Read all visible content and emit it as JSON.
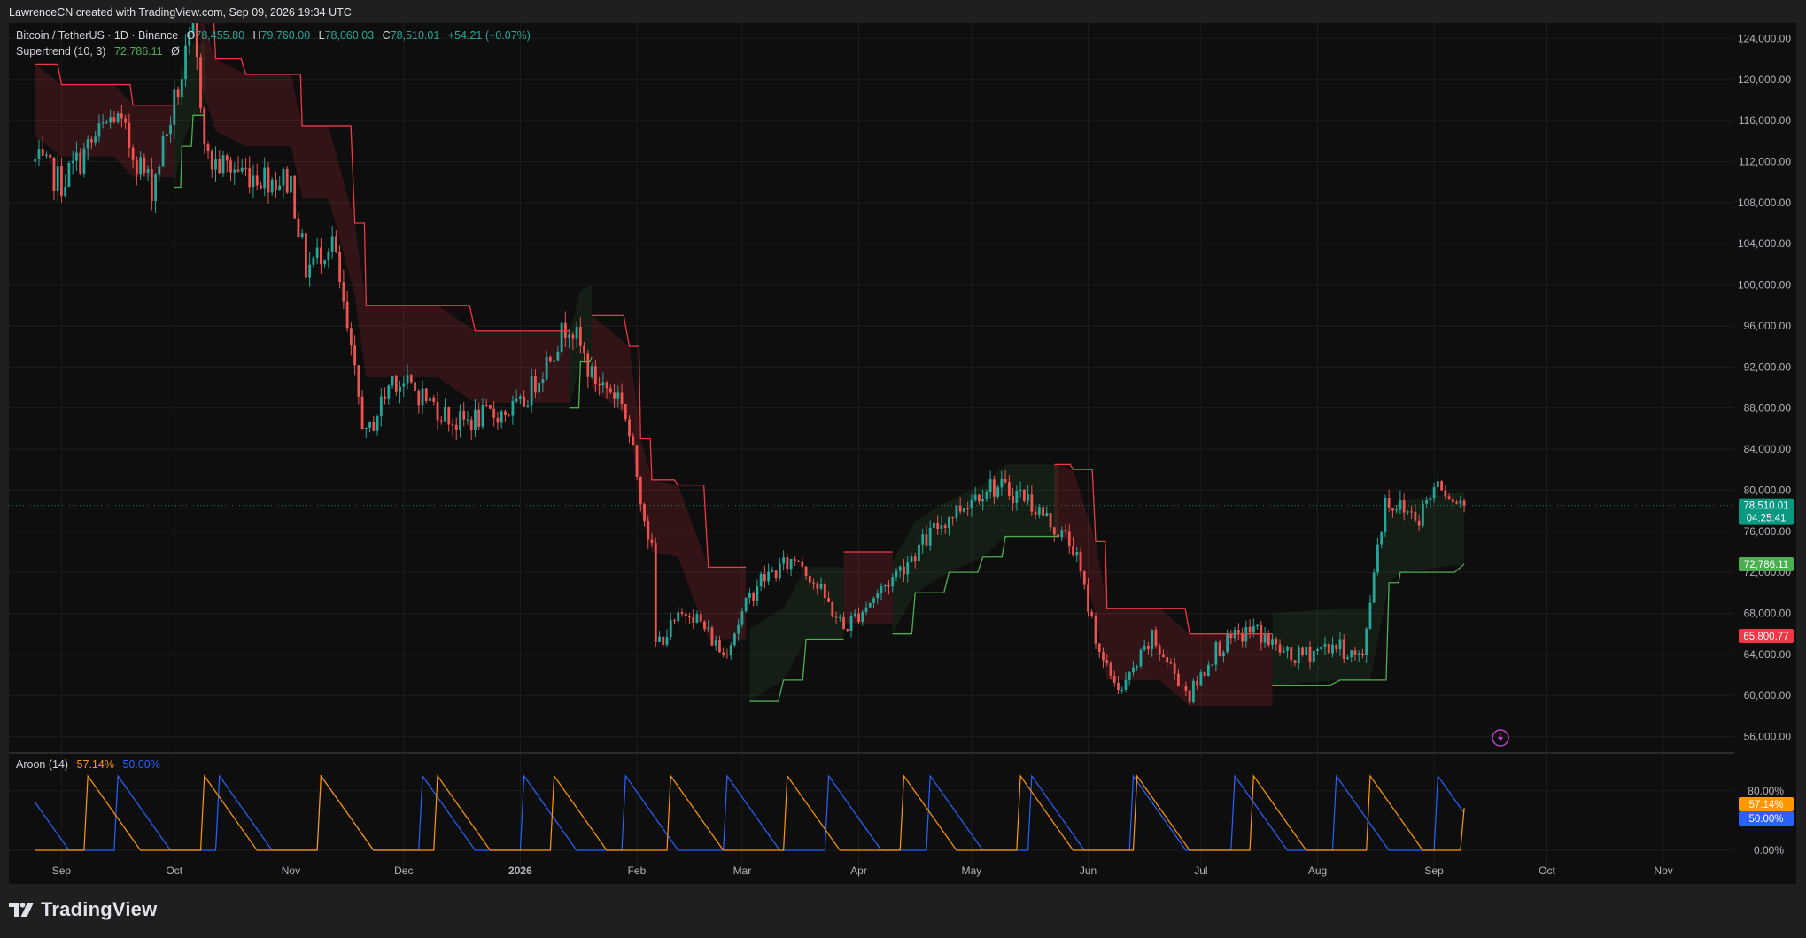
{
  "header": {
    "credit": "LawrenceCN created with TradingView.com, Sep 09, 2026 19:34 UTC"
  },
  "legend": {
    "symbol": "Bitcoin / TetherUS · 1D · Binance",
    "o_label": "O",
    "o_value": "78,455.80",
    "h_label": "H",
    "h_value": "79,760.00",
    "l_label": "L",
    "l_value": "78,060.03",
    "c_label": "C",
    "c_value": "78,510.01",
    "change": "+54.21 (+0.07%)",
    "supertrend_label": "Supertrend (10, 3)",
    "supertrend_value": "72,786.11",
    "supertrend_extra": "Ø",
    "aroon_label": "Aroon (14)",
    "aroon_up": "57.14%",
    "aroon_down": "50.00%"
  },
  "price_badges": {
    "last_price": "78,510.01",
    "countdown": "04:25:41",
    "supertrend_up": "72,786.11",
    "supertrend_down": "65,800.77"
  },
  "oscillator_badges": {
    "up": "57.14%",
    "down": "50.00%"
  },
  "brand": {
    "name": "TradingView"
  },
  "colors": {
    "up": "#26a69a",
    "down": "#ef5350",
    "supertrend_up": "#4caf50",
    "supertrend_down": "#f23645",
    "aroon_up": "#ff9800",
    "aroon_down": "#2962ff"
  },
  "chart_data": {
    "type": "candlestick",
    "y_axis": {
      "range": [
        54500,
        125500
      ],
      "ticks": [
        56000,
        60000,
        64000,
        68000,
        72000,
        76000,
        80000,
        84000,
        88000,
        92000,
        96000,
        100000,
        104000,
        108000,
        112000,
        116000,
        120000,
        124000
      ],
      "tick_labels": [
        "56,000.00",
        "60,000.00",
        "64,000.00",
        "68,000.00",
        "72,000.00",
        "76,000.00",
        "80,000.00",
        "84,000.00",
        "88,000.00",
        "92,000.00",
        "96,000.00",
        "100,000.00",
        "104,000.00",
        "108,000.00",
        "112,000.00",
        "116,000.00",
        "120,000.00",
        "124,000.00"
      ]
    },
    "x_axis": {
      "labels": [
        "Sep",
        "Oct",
        "Nov",
        "Dec",
        "2026",
        "Feb",
        "Mar",
        "Apr",
        "May",
        "Jun",
        "Jul",
        "Aug",
        "Sep",
        "Oct",
        "Nov"
      ]
    },
    "price_points": [
      {
        "date": "2025-08-25",
        "close": 112000
      },
      {
        "date": "2025-09-01",
        "close": 110000
      },
      {
        "date": "2025-09-15",
        "close": 116500
      },
      {
        "date": "2025-09-25",
        "close": 109500
      },
      {
        "date": "2025-10-06",
        "close": 124500
      },
      {
        "date": "2025-10-10",
        "close": 112000
      },
      {
        "date": "2025-10-20",
        "close": 111000
      },
      {
        "date": "2025-11-01",
        "close": 110000
      },
      {
        "date": "2025-11-05",
        "close": 101500
      },
      {
        "date": "2025-11-12",
        "close": 104500
      },
      {
        "date": "2025-11-17",
        "close": 93000
      },
      {
        "date": "2025-11-21",
        "close": 85000
      },
      {
        "date": "2025-11-28",
        "close": 91000
      },
      {
        "date": "2025-12-05",
        "close": 89500
      },
      {
        "date": "2025-12-15",
        "close": 86500
      },
      {
        "date": "2026-01-01",
        "close": 88000
      },
      {
        "date": "2026-01-14",
        "close": 96500
      },
      {
        "date": "2026-01-20",
        "close": 91000
      },
      {
        "date": "2026-01-28",
        "close": 89000
      },
      {
        "date": "2026-02-05",
        "close": 74000
      },
      {
        "date": "2026-02-06",
        "close": 65000
      },
      {
        "date": "2026-02-15",
        "close": 68500
      },
      {
        "date": "2026-02-24",
        "close": 64000
      },
      {
        "date": "2026-03-05",
        "close": 71000
      },
      {
        "date": "2026-03-16",
        "close": 73500
      },
      {
        "date": "2026-03-28",
        "close": 66500
      },
      {
        "date": "2026-04-10",
        "close": 71500
      },
      {
        "date": "2026-04-22",
        "close": 76500
      },
      {
        "date": "2026-05-05",
        "close": 80500
      },
      {
        "date": "2026-05-15",
        "close": 79500
      },
      {
        "date": "2026-05-28",
        "close": 74500
      },
      {
        "date": "2026-06-05",
        "close": 63000
      },
      {
        "date": "2026-06-10",
        "close": 60500
      },
      {
        "date": "2026-06-18",
        "close": 65500
      },
      {
        "date": "2026-06-28",
        "close": 60000
      },
      {
        "date": "2026-07-05",
        "close": 64500
      },
      {
        "date": "2026-07-15",
        "close": 66500
      },
      {
        "date": "2026-07-25",
        "close": 63500
      },
      {
        "date": "2026-08-05",
        "close": 65000
      },
      {
        "date": "2026-08-13",
        "close": 63500
      },
      {
        "date": "2026-08-16",
        "close": 72500
      },
      {
        "date": "2026-08-19",
        "close": 79000
      },
      {
        "date": "2026-08-28",
        "close": 77500
      },
      {
        "date": "2026-09-02",
        "close": 81000
      },
      {
        "date": "2026-09-09",
        "close": 78510
      }
    ],
    "supertrend_segments": [
      {
        "dir": "down",
        "points": [
          [
            "2025-08-25",
            121500
          ],
          [
            "2025-09-01",
            119500
          ],
          [
            "2025-09-15",
            119500
          ],
          [
            "2025-09-20",
            117500
          ],
          [
            "2025-10-01",
            117500
          ]
        ]
      },
      {
        "dir": "up",
        "points": [
          [
            "2025-10-01",
            109500
          ],
          [
            "2025-10-03",
            113500
          ],
          [
            "2025-10-06",
            116500
          ],
          [
            "2025-10-09",
            116500
          ]
        ]
      },
      {
        "dir": "down",
        "points": [
          [
            "2025-10-08",
            126500
          ],
          [
            "2025-10-12",
            122000
          ],
          [
            "2025-10-20",
            120500
          ],
          [
            "2025-11-01",
            120500
          ],
          [
            "2025-11-04",
            115500
          ],
          [
            "2025-11-11",
            115500
          ],
          [
            "2025-11-18",
            106000
          ],
          [
            "2025-11-21",
            98000
          ],
          [
            "2025-12-10",
            98000
          ],
          [
            "2025-12-20",
            95500
          ],
          [
            "2026-01-14",
            95500
          ]
        ]
      },
      {
        "dir": "up",
        "points": [
          [
            "2026-01-14",
            88000
          ],
          [
            "2026-01-17",
            92500
          ],
          [
            "2026-01-20",
            93000
          ]
        ]
      },
      {
        "dir": "down",
        "points": [
          [
            "2026-01-20",
            97000
          ],
          [
            "2026-01-30",
            94000
          ],
          [
            "2026-02-02",
            85000
          ],
          [
            "2026-02-05",
            81000
          ],
          [
            "2026-02-12",
            80500
          ],
          [
            "2026-02-20",
            72500
          ],
          [
            "2026-03-02",
            72500
          ]
        ]
      },
      {
        "dir": "up",
        "points": [
          [
            "2026-03-03",
            59500
          ],
          [
            "2026-03-12",
            61500
          ],
          [
            "2026-03-18",
            65500
          ],
          [
            "2026-03-28",
            65500
          ]
        ]
      },
      {
        "dir": "down",
        "points": [
          [
            "2026-03-28",
            74000
          ],
          [
            "2026-04-10",
            74000
          ]
        ]
      },
      {
        "dir": "up",
        "points": [
          [
            "2026-04-10",
            66000
          ],
          [
            "2026-04-16",
            70000
          ],
          [
            "2026-04-25",
            72000
          ],
          [
            "2026-05-04",
            73500
          ],
          [
            "2026-05-10",
            75500
          ],
          [
            "2026-05-24",
            75500
          ]
        ]
      },
      {
        "dir": "down",
        "points": [
          [
            "2026-05-23",
            82500
          ],
          [
            "2026-05-28",
            82000
          ],
          [
            "2026-06-03",
            75000
          ],
          [
            "2026-06-06",
            68500
          ],
          [
            "2026-06-20",
            68500
          ],
          [
            "2026-06-28",
            66000
          ],
          [
            "2026-07-20",
            66000
          ]
        ]
      },
      {
        "dir": "up",
        "points": [
          [
            "2026-07-20",
            61000
          ],
          [
            "2026-08-07",
            61500
          ],
          [
            "2026-08-15",
            61500
          ],
          [
            "2026-08-20",
            71000
          ],
          [
            "2026-08-23",
            72000
          ],
          [
            "2026-09-09",
            72786
          ]
        ]
      }
    ],
    "aroon": {
      "range": [
        0,
        100
      ],
      "ticks": [
        0,
        80
      ],
      "tick_labels": [
        "0.00%",
        "80.00%"
      ],
      "up_last": 57.14,
      "down_last": 50.0
    }
  }
}
